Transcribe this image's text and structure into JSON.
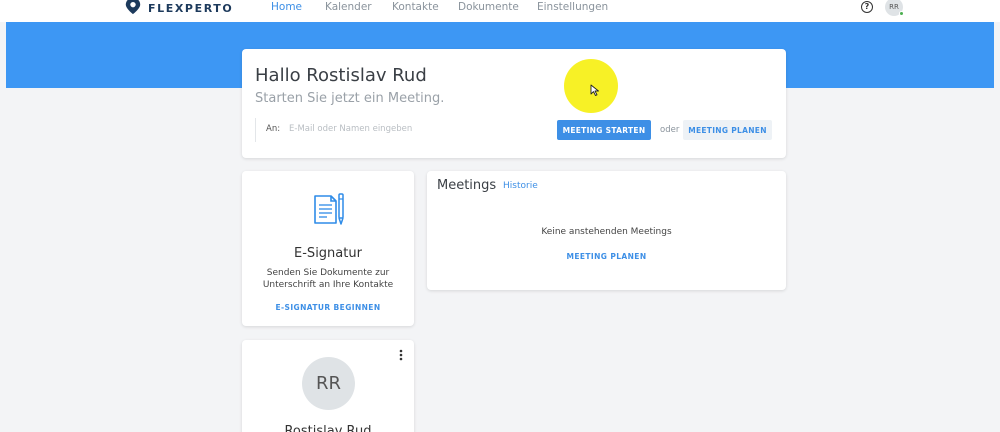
{
  "brand": {
    "name": "FLEXPERTO",
    "color": "#1d3a5c"
  },
  "nav": {
    "items": [
      {
        "label": "Home",
        "active": true
      },
      {
        "label": "Kalender",
        "active": false
      },
      {
        "label": "Kontakte",
        "active": false
      },
      {
        "label": "Dokumente",
        "active": false
      },
      {
        "label": "Einstellungen",
        "active": false
      }
    ],
    "help_icon": "help-circle-icon",
    "user_initials": "RR",
    "user_status": "online"
  },
  "colors": {
    "accent": "#3d8fe6",
    "band": "#3d97f4",
    "background": "#f3f4f6"
  },
  "hero": {
    "greeting": "Hallo Rostislav Rud",
    "subtitle": "Starten Sie jetzt ein Meeting.",
    "to_label": "An:",
    "to_placeholder": "E-Mail oder Namen eingeben",
    "start_button": "MEETING STARTEN",
    "or_text": "oder",
    "plan_button": "MEETING PLANEN"
  },
  "esignatur": {
    "icon": "document-pen-icon",
    "title": "E-Signatur",
    "description": "Senden Sie Dokumente zur Unterschrift an Ihre Kontakte",
    "link": "E-SIGNATUR BEGINNEN"
  },
  "meetings": {
    "title": "Meetings",
    "history_link": "Historie",
    "empty_text": "Keine anstehenden Meetings",
    "plan_link": "MEETING PLANEN"
  },
  "profile": {
    "initials": "RR",
    "name": "Rostislav Rud",
    "menu_icon": "more-vertical-icon"
  }
}
